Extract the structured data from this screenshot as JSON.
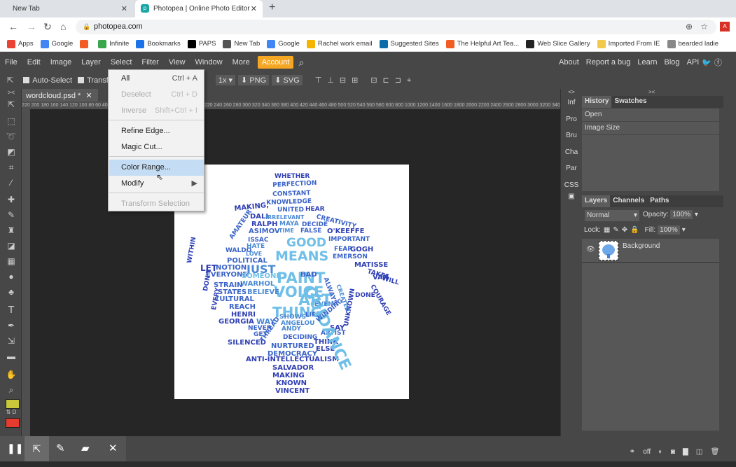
{
  "browser": {
    "tabs": [
      {
        "label": "New Tab",
        "active": false
      },
      {
        "label": "Photopea | Online Photo Editor",
        "active": true
      }
    ],
    "url": "photopea.com",
    "bookmarks": [
      {
        "label": "Apps",
        "color": "#ea4335"
      },
      {
        "label": "Google",
        "color": "#4285f4"
      },
      {
        "label": "",
        "color": "#f25c24"
      },
      {
        "label": "Infinite",
        "color": "#3aa64c"
      },
      {
        "label": "Bookmarks",
        "color": "#1a73e8"
      },
      {
        "label": "PAPS",
        "color": "#000000"
      },
      {
        "label": "New Tab",
        "color": "#555555"
      },
      {
        "label": "Google",
        "color": "#4285f4"
      },
      {
        "label": "Rachel work email",
        "color": "#f4b400"
      },
      {
        "label": "Suggested Sites",
        "color": "#0b6ea8"
      },
      {
        "label": "The Helpful Art Tea...",
        "color": "#f25c24"
      },
      {
        "label": "Web Slice Gallery",
        "color": "#222222"
      },
      {
        "label": "Imported From IE",
        "color": "#f2c94c"
      },
      {
        "label": "bearded ladie",
        "color": "#888888"
      }
    ]
  },
  "menubar": {
    "items": [
      "File",
      "Edit",
      "Image",
      "Layer",
      "Select",
      "Filter",
      "View",
      "Window",
      "More"
    ],
    "account": "Account",
    "right_links": [
      "About",
      "Report a bug",
      "Learn",
      "Blog",
      "API"
    ]
  },
  "options": {
    "auto_select": "Auto-Select",
    "transform": "Transf",
    "zoom": "1x",
    "png": "PNG",
    "svg": "SVG"
  },
  "document": {
    "tab_label": "wordcloud.psd *",
    "close": "✕",
    "ruler_ticks": "220  200  180  160  140  120  100  80  60  40  20  0  20  40  60  80  100  120  140  160  180  200  220  240  260  280  300  320  340  360  380  400  420  440  460  480  500  520  540  560  580  600  800  1000  1200  1400  1600  1800  2000  2200  2400  2600  2800  3000  3200  3400  3600  3800  4000  4200  4400  4600  4800  5000  5200"
  },
  "select_menu": {
    "items": [
      {
        "label": "All",
        "shortcut": "Ctrl + A",
        "disabled": false
      },
      {
        "label": "Deselect",
        "shortcut": "Ctrl + D",
        "disabled": true
      },
      {
        "label": "Inverse",
        "shortcut": "Shift+Ctrl + I",
        "disabled": true
      },
      {
        "label": "Refine Edge...",
        "shortcut": "",
        "disabled": false
      },
      {
        "label": "Magic Cut...",
        "shortcut": "",
        "disabled": false
      },
      {
        "label": "Color Range...",
        "shortcut": "",
        "disabled": false,
        "highlighted": true
      },
      {
        "label": "Modify",
        "shortcut": "▶",
        "disabled": false
      },
      {
        "label": "Transform Selection",
        "shortcut": "",
        "disabled": true
      }
    ]
  },
  "collapsed_panels": [
    "Inf",
    "Pro",
    "Bru",
    "Cha",
    "Par",
    "CSS"
  ],
  "history_panel": {
    "tabs": [
      "History",
      "Swatches"
    ],
    "entries": [
      "Open",
      "Image Size"
    ]
  },
  "layers_panel": {
    "tabs": [
      "Layers",
      "Channels",
      "Paths"
    ],
    "blend_mode": "Normal",
    "opacity_label": "Opacity:",
    "opacity": "100%",
    "lock_label": "Lock:",
    "fill_label": "Fill:",
    "fill": "100%",
    "layers": [
      {
        "name": "Background",
        "visible": true
      }
    ],
    "footer_icons": [
      "link-icon",
      "off",
      "fx-icon",
      "mask-icon",
      "folder-icon",
      "new-layer-icon",
      "trash-icon"
    ],
    "footer_off": "off"
  },
  "colors": {
    "foreground": "#c8c83a",
    "background": "#e63b2e",
    "accent": "#f5a623"
  },
  "wordcloud": {
    "words": [
      {
        "t": "WHETHER",
        "c": "#2f3fb4"
      },
      {
        "t": "PERFECTION",
        "c": "#3a63c8"
      },
      {
        "t": "CONSTANT",
        "c": "#3a63c8"
      },
      {
        "t": "KNOWLEDGE",
        "c": "#3a63c8"
      },
      {
        "t": "MAKING,",
        "c": "#2f3fb4"
      },
      {
        "t": "UNITED",
        "c": "#3a63c8"
      },
      {
        "t": "HEAR",
        "c": "#2f3fb4"
      },
      {
        "t": "DALI",
        "c": "#2f3fb4"
      },
      {
        "t": "IRRELEVANT",
        "c": "#4a8ad4"
      },
      {
        "t": "CREATIVITY",
        "c": "#3a63c8"
      },
      {
        "t": "RALPH",
        "c": "#2f3fb4"
      },
      {
        "t": "MAYA",
        "c": "#4a8ad4"
      },
      {
        "t": "DECIDE",
        "c": "#3a63c8"
      },
      {
        "t": "ASIMOV",
        "c": "#3a63c8"
      },
      {
        "t": "TIME",
        "c": "#4a8ad4"
      },
      {
        "t": "FALSE",
        "c": "#3a63c8"
      },
      {
        "t": "O'KEEFFE",
        "c": "#2f3fb4"
      },
      {
        "t": "GOOD",
        "c": "#6fbfe8"
      },
      {
        "t": "IMPORTANT",
        "c": "#3a63c8"
      },
      {
        "t": "ISSAC",
        "c": "#3a63c8"
      },
      {
        "t": "MEANS",
        "c": "#6fbfe8"
      },
      {
        "t": "FEAR",
        "c": "#3a63c8"
      },
      {
        "t": "GOGH",
        "c": "#2f3fb4"
      },
      {
        "t": "WALDO",
        "c": "#3a63c8"
      },
      {
        "t": "HATE",
        "c": "#4a8ad4"
      },
      {
        "t": "EMERSON",
        "c": "#3a63c8"
      },
      {
        "t": "LOVE",
        "c": "#4a8ad4"
      },
      {
        "t": "POLITICAL",
        "c": "#3a63c8"
      },
      {
        "t": "JUST",
        "c": "#4a8ad4"
      },
      {
        "t": "PAINT",
        "c": "#6fbfe8"
      },
      {
        "t": "MATISSE",
        "c": "#2f3fb4"
      },
      {
        "t": "LET",
        "c": "#2f3fb4"
      },
      {
        "t": "NOTION",
        "c": "#3a63c8"
      },
      {
        "t": "TAKES",
        "c": "#2f3fb4"
      },
      {
        "t": "WILL",
        "c": "#2f3fb4"
      },
      {
        "t": "EVERYONE",
        "c": "#3a63c8"
      },
      {
        "t": "SOMEONE",
        "c": "#6fbfe8"
      },
      {
        "t": "VAN",
        "c": "#2f3fb4"
      },
      {
        "t": "BAD",
        "c": "#3a63c8"
      },
      {
        "t": "WARHOL",
        "c": "#4a8ad4"
      },
      {
        "t": "VOICE",
        "c": "#6fbfe8"
      },
      {
        "t": "STRAIN",
        "c": "#3a63c8"
      },
      {
        "t": "STATES",
        "c": "#3a63c8"
      },
      {
        "t": "BELIEVE",
        "c": "#4a8ad4"
      },
      {
        "t": "ART",
        "c": "#6fbfe8"
      },
      {
        "t": "CULTURAL",
        "c": "#3a63c8"
      },
      {
        "t": "DONE",
        "c": "#2f3fb4"
      },
      {
        "t": "REACH",
        "c": "#3a63c8"
      },
      {
        "t": "THING",
        "c": "#6fbfe8"
      },
      {
        "t": "EVEN",
        "c": "#4a8ad4"
      },
      {
        "t": "HENRI",
        "c": "#2f3fb4"
      },
      {
        "t": "SHOWS",
        "c": "#4a8ad4"
      },
      {
        "t": "LIFE",
        "c": "#3a63c8"
      },
      {
        "t": "GEORGIA",
        "c": "#2f3fb4"
      },
      {
        "t": "WAY",
        "c": "#4a8ad4"
      },
      {
        "t": "SAY",
        "c": "#2f3fb4"
      },
      {
        "t": "NEVER",
        "c": "#3a63c8"
      },
      {
        "t": "ANGELOU",
        "c": "#4a8ad4"
      },
      {
        "t": "ANDY",
        "c": "#4a8ad4"
      },
      {
        "t": "ARTIST",
        "c": "#3a63c8"
      },
      {
        "t": "GET",
        "c": "#3a63c8"
      },
      {
        "t": "DECIDING",
        "c": "#3a63c8"
      },
      {
        "t": "THINK",
        "c": "#2f3fb4"
      },
      {
        "t": "SILENCED",
        "c": "#2f3fb4"
      },
      {
        "t": "NURTURED",
        "c": "#3a63c8"
      },
      {
        "t": "ELSE",
        "c": "#2f3fb4"
      },
      {
        "t": "DEMOCRACY",
        "c": "#3a63c8"
      },
      {
        "t": "ANTI-INTELLECTUALISM",
        "c": "#2f3fb4"
      },
      {
        "t": "SALVADOR",
        "c": "#2f3fb4"
      },
      {
        "t": "MAKING",
        "c": "#2f3fb4"
      },
      {
        "t": "KNOWN",
        "c": "#2f3fb4"
      },
      {
        "t": "VINCENT",
        "c": "#2f3fb4"
      },
      {
        "t": "WITHIN",
        "c": "#2f3fb4"
      },
      {
        "t": "DON'T",
        "c": "#2f3fb4"
      },
      {
        "t": "EVERY",
        "c": "#2f3fb4"
      },
      {
        "t": "AMATEUR",
        "c": "#3a63c8"
      },
      {
        "t": "GUIDANCE",
        "c": "#6fbfe8"
      },
      {
        "t": "COURAGE",
        "c": "#2f3fb4"
      },
      {
        "t": "UNKNOWN",
        "c": "#2f3fb4"
      },
      {
        "t": "WINDING",
        "c": "#3a63c8"
      },
      {
        "t": "THREAD",
        "c": "#3a63c8"
      },
      {
        "t": "ALWAYS",
        "c": "#3a63c8"
      },
      {
        "t": "CREATED",
        "c": "#4a8ad4"
      }
    ]
  }
}
